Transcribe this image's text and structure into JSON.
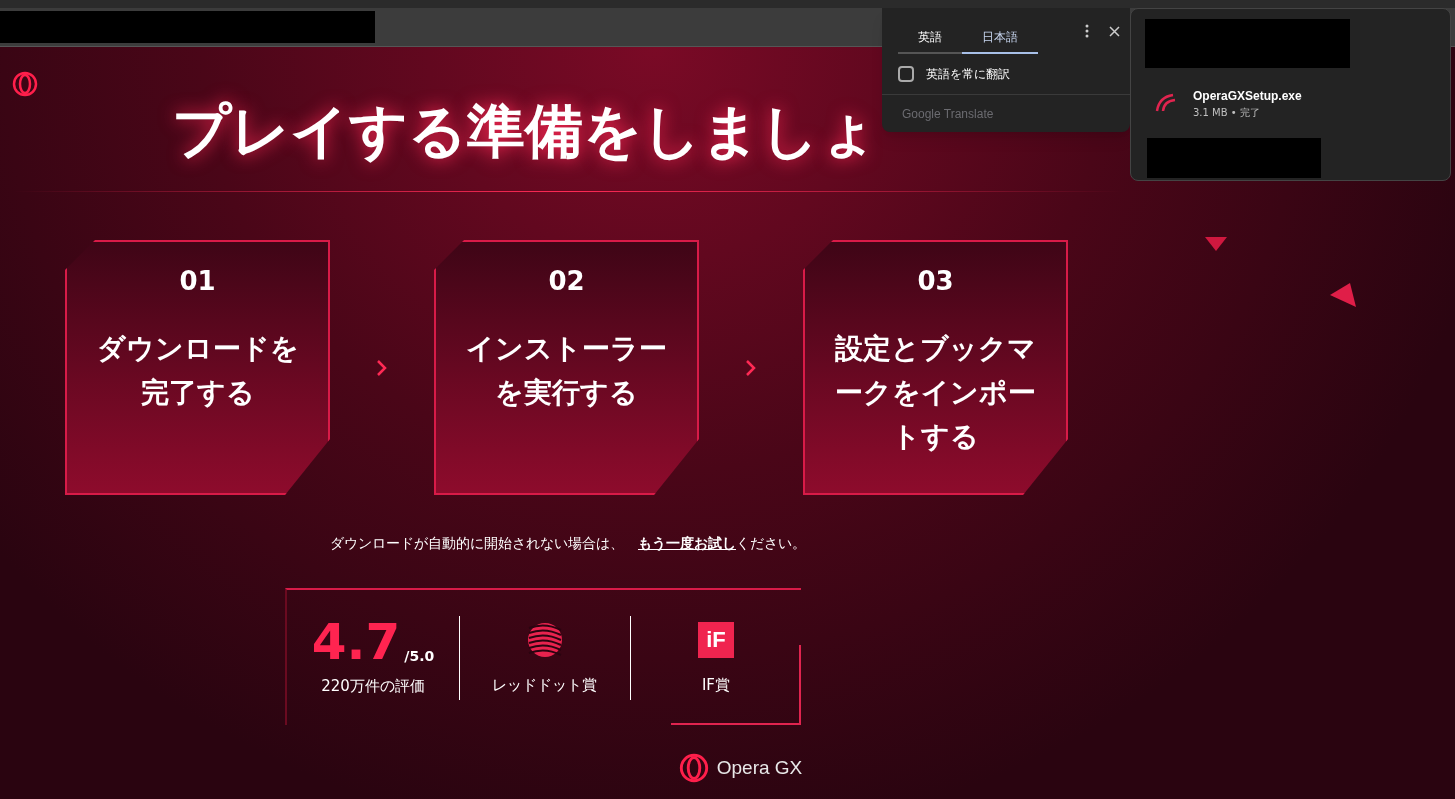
{
  "translate_popup": {
    "tabs": [
      {
        "label": "英語",
        "selected": false
      },
      {
        "label": "日本語",
        "selected": true
      }
    ],
    "option": {
      "label": "英語を常に翻訳",
      "checked": false
    },
    "footer": "Google Translate"
  },
  "downloads": {
    "items": [
      {
        "name": "OperaGXSetup.exe",
        "meta": "3.1 MB • 完了"
      }
    ]
  },
  "page": {
    "title": "プレイする準備をしましょ",
    "steps": [
      {
        "number": "01",
        "text": "ダウンロードを完了する"
      },
      {
        "number": "02",
        "text": "インストーラーを実行する"
      },
      {
        "number": "03",
        "text": "設定とブックマークをインポートする"
      }
    ],
    "retry": {
      "before": "ダウンロードが自動的に開始されない場合は、",
      "link": "もう一度お試し",
      "after": "ください。"
    },
    "rating": {
      "score": "4.7",
      "scale": "/5.0",
      "caption": "220万件の評価"
    },
    "awards": [
      {
        "kind": "reddot",
        "label": "レッドドット賞"
      },
      {
        "kind": "if",
        "logo_text": "iF",
        "label": "IF賞"
      }
    ],
    "brand": "Opera GX"
  }
}
